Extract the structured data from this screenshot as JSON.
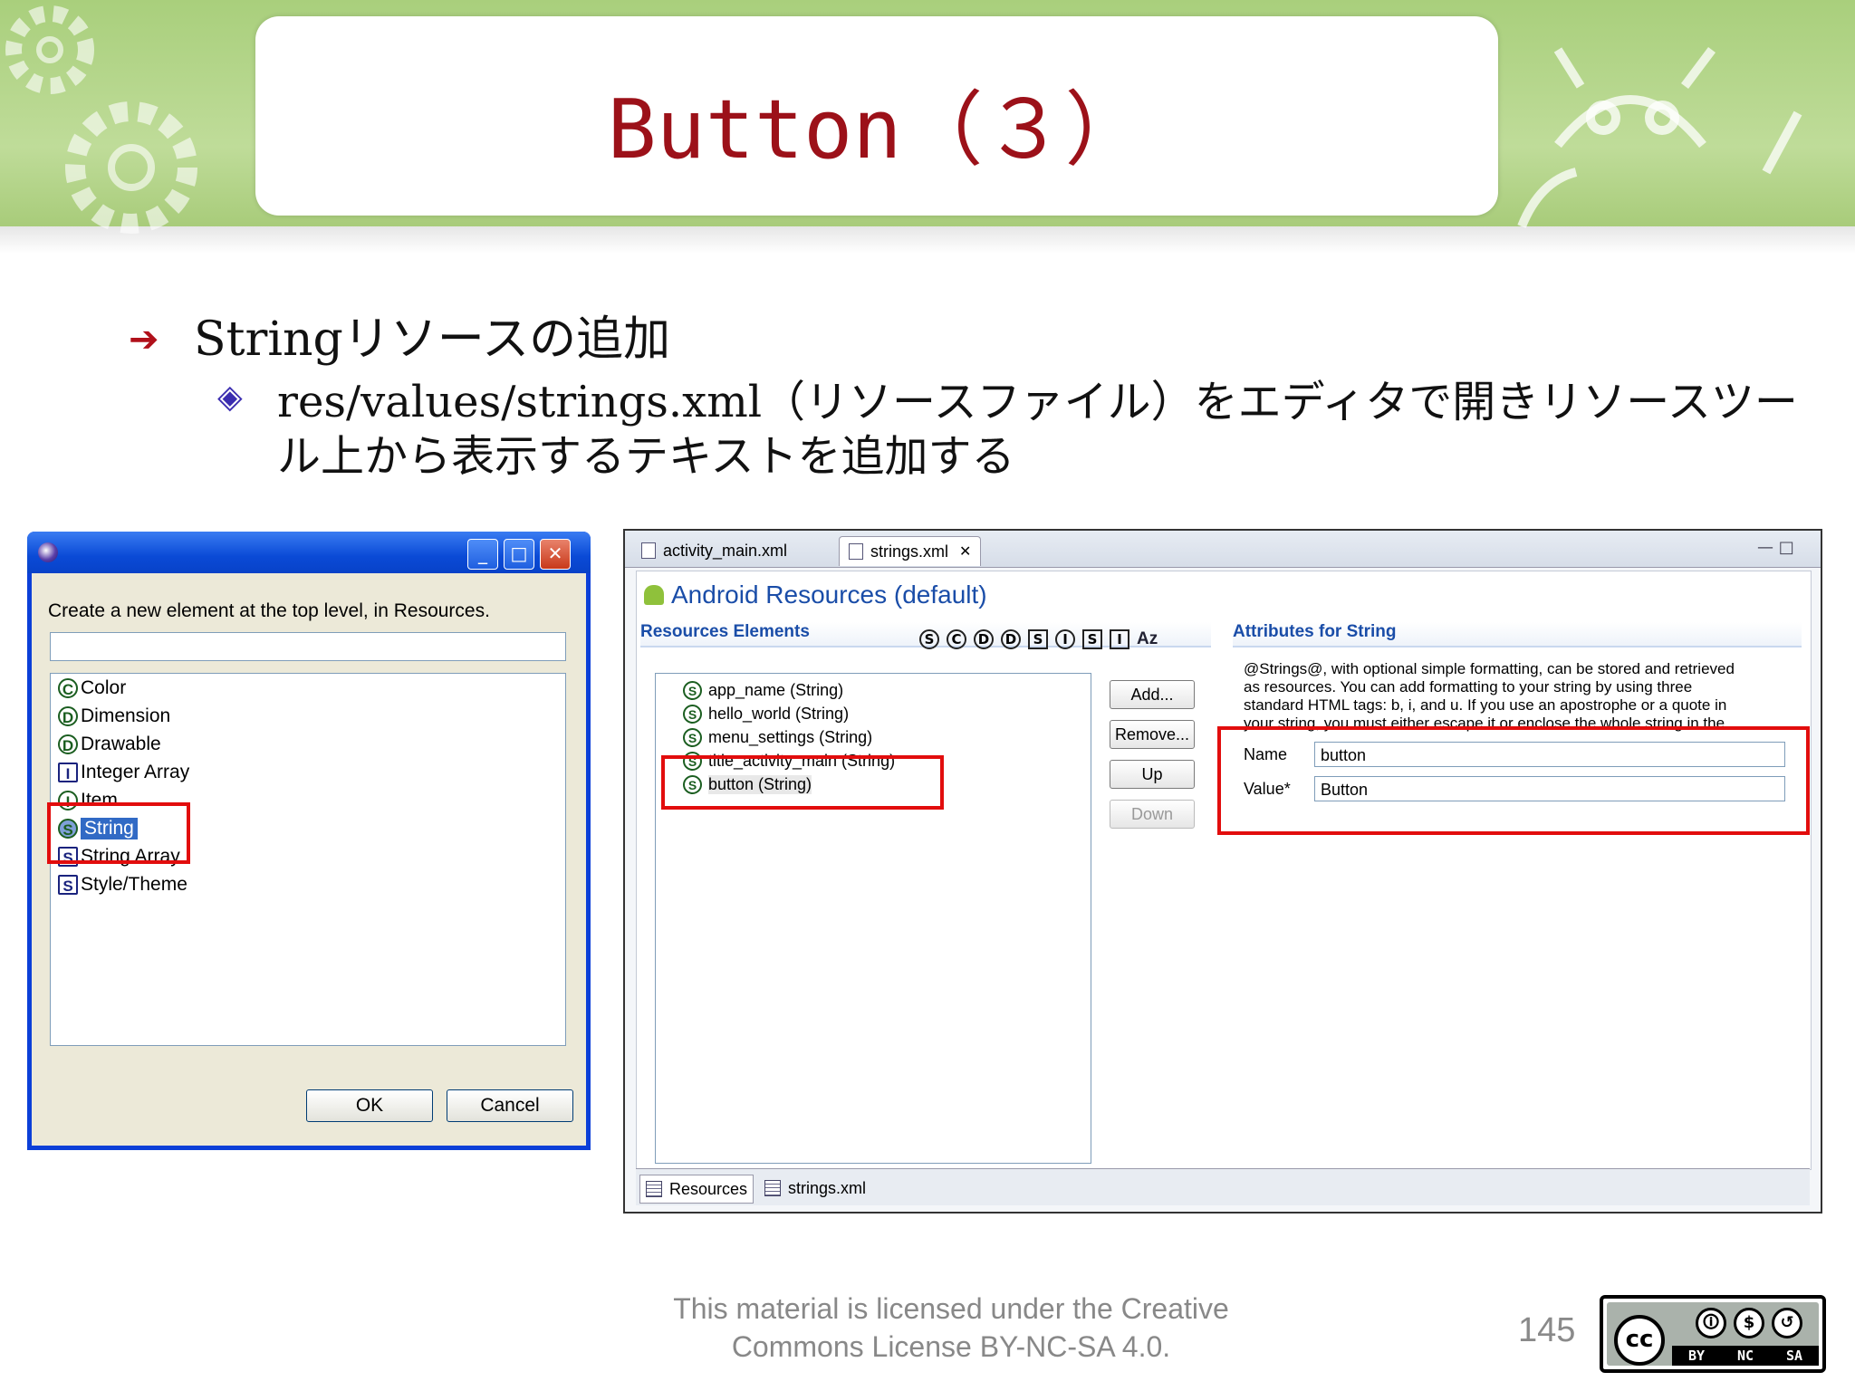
{
  "slide": {
    "title": "Button（３）",
    "bullet1": "Stringリソースの追加",
    "bullet2": "res/values/strings.xml（リソースファイル）をエディタで開きリソースツール上から表示するテキストを追加する",
    "bullet1_icon": "arrow-bullet-icon",
    "bullet2_icon": "diamond-bullet-icon",
    "title_color": "#9c1119",
    "highlight_color": "#e20d0d"
  },
  "dialog": {
    "prompt": "Create a new element at the top level, in Resources.",
    "filter_value": "",
    "items": [
      {
        "glyph": "C",
        "label": "Color"
      },
      {
        "glyph": "D",
        "label": "Dimension"
      },
      {
        "glyph": "D",
        "label": "Drawable"
      },
      {
        "glyph": "I",
        "label": "Integer Array"
      },
      {
        "glyph": "I",
        "label": "Item"
      },
      {
        "glyph": "S",
        "label": "String"
      },
      {
        "glyph": "S",
        "label": "String Array"
      },
      {
        "glyph": "S",
        "label": "Style/Theme"
      }
    ],
    "selected_item": "String",
    "ok_label": "OK",
    "cancel_label": "Cancel"
  },
  "editor": {
    "tabs": [
      "activity_main.xml",
      "strings.xml"
    ],
    "active_tab": "strings.xml",
    "heading": "Android Resources (default)",
    "left_section": "Resources Elements",
    "right_section": "Attributes for String",
    "filter_glyphs": [
      "S",
      "C",
      "D",
      "D",
      "S",
      "I",
      "S",
      "I"
    ],
    "sort_label": "Az",
    "tree_items": [
      "app_name (String)",
      "hello_world (String)",
      "menu_settings (String)",
      "title_activity_main (String)",
      "button (String)"
    ],
    "selected_tree_item": "button (String)",
    "buttons": {
      "add": "Add...",
      "remove": "Remove...",
      "up": "Up",
      "down": "Down"
    },
    "description": "@Strings@, with optional simple formatting, can be stored and retrieved as resources. You can add formatting to your string by using three standard HTML tags: b, i, and u. If you use an apostrophe or a quote in your string, you must either escape it or enclose the whole string in the other kind of enclosing quotes.",
    "name_label": "Name",
    "name_value": "button",
    "value_label": "Value*",
    "value_value": "Button",
    "bottom_tabs": [
      "Resources",
      "strings.xml"
    ]
  },
  "footer": {
    "license_line1": "This material is licensed under the Creative",
    "license_line2": "Commons License BY-NC-SA 4.0.",
    "page_number": "145",
    "cc_logo": "cc",
    "cc_labels": [
      "BY",
      "NC",
      "SA"
    ]
  }
}
